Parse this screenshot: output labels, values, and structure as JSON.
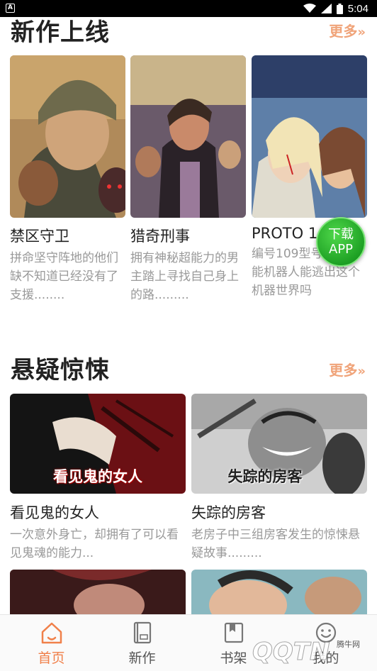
{
  "status_bar": {
    "time": "5:04",
    "notification_badge": "A"
  },
  "sections": [
    {
      "title": "新作上线",
      "more_label": "更多",
      "more_arrow": "»",
      "items": [
        {
          "name": "禁区守卫",
          "desc": "拼命坚守阵地的他们缺不知道已经没有了支援........"
        },
        {
          "name": "猎奇刑事",
          "desc": "拥有神秘超能力的男主踏上寻找自己身上的路........."
        },
        {
          "name": "PROTO 1",
          "desc": "编号109型号特殊只能机器人能逃出这个机器世界吗"
        }
      ]
    },
    {
      "title": "悬疑惊悚",
      "more_label": "更多",
      "more_arrow": "»",
      "items": [
        {
          "name": "看见鬼的女人",
          "desc": "一次意外身亡，却拥有了可以看见鬼魂的能力...",
          "cover_text": "看见鬼的女人"
        },
        {
          "name": "失踪的房客",
          "desc": "老房子中三组房客发生的惊悚悬疑故事.........",
          "cover_text": "失踪的房客"
        }
      ]
    }
  ],
  "download_fab": {
    "line1": "下载",
    "line2": "APP"
  },
  "bottom_nav": [
    {
      "label": "首页",
      "icon": "home-icon",
      "active": true
    },
    {
      "label": "新作",
      "icon": "book-icon",
      "active": false
    },
    {
      "label": "书架",
      "icon": "bookshelf-icon",
      "active": false
    },
    {
      "label": "我的",
      "icon": "smiley-icon",
      "active": false
    }
  ],
  "watermark": {
    "brand": "QQTN",
    "tag": "腾牛网"
  },
  "colors": {
    "accent": "#f0804a",
    "more": "#f0a47a",
    "fab": "#2fb82e"
  }
}
